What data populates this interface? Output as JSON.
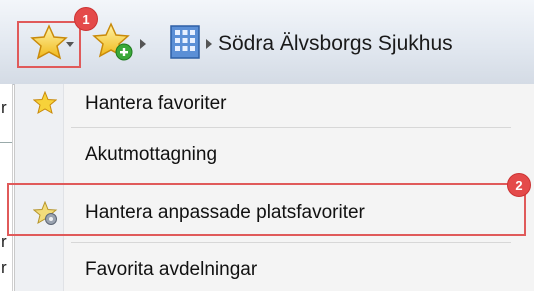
{
  "toolbar": {
    "favorites_icon": "star-icon",
    "add_favorite_icon": "star-add-icon",
    "unit_icon": "building-icon",
    "unit_label": "Södra Älvsborgs Sjukhus"
  },
  "badges": [
    "1",
    "2"
  ],
  "menu": {
    "items": [
      {
        "label": "Hantera favoriter",
        "icon": "star-icon"
      },
      {
        "label": "Akutmottagning",
        "icon": ""
      },
      {
        "label": "Hantera anpassade platsfavoriter",
        "icon": "star-gear-icon"
      },
      {
        "label": "Favorita avdelningar",
        "icon": ""
      }
    ]
  },
  "background_fragments": [
    "r",
    "r",
    "r"
  ],
  "colors": {
    "highlight": "#e05a5a",
    "badge": "#e44a4a",
    "star_fill": "#f7d23a"
  }
}
